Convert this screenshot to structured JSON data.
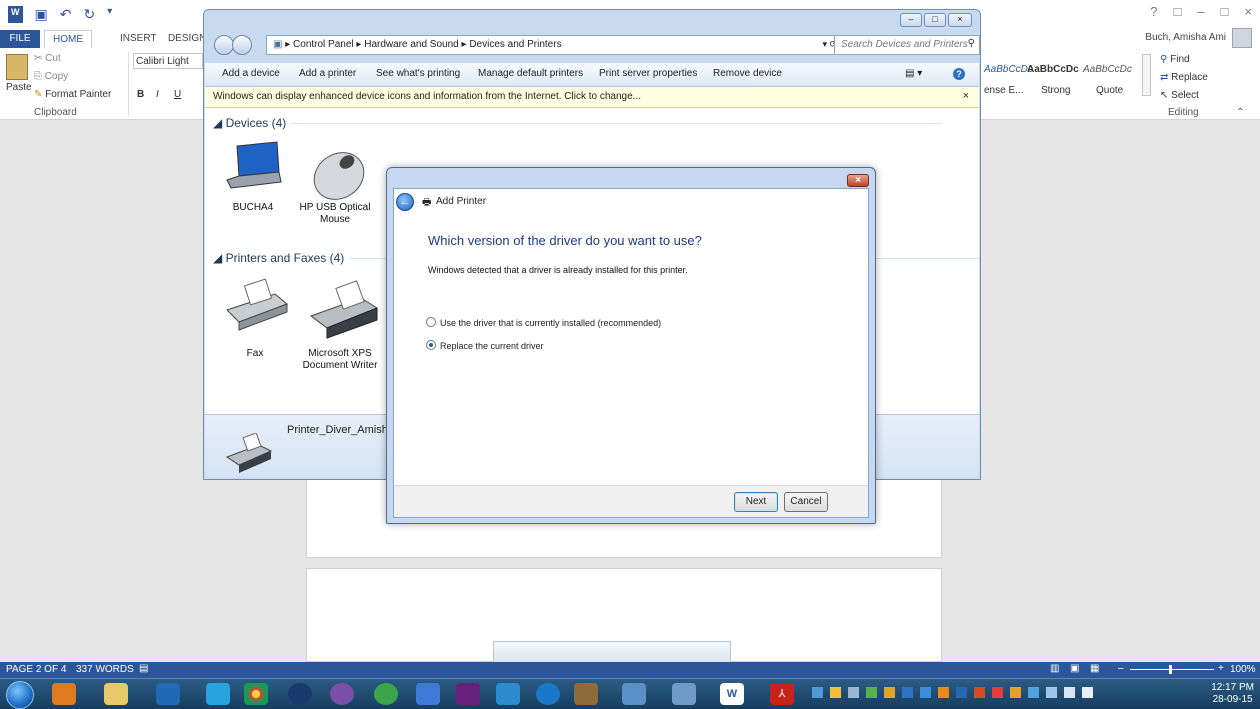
{
  "word": {
    "title_controls": [
      "?",
      "□",
      "–",
      "□",
      "×"
    ],
    "tabs": {
      "file": "FILE",
      "home": "HOME",
      "insert": "INSERT",
      "design": "DESIGN"
    },
    "clipboard": {
      "cut": "Cut",
      "copy": "Copy",
      "paste": "Paste",
      "format_painter": "Format Painter",
      "group_label": "Clipboard"
    },
    "font": {
      "name": "Calibri Light",
      "bold": "B",
      "italic": "I",
      "underline": "U"
    },
    "styles": {
      "style1": "AaBbCcDc",
      "style2": "AaBbCcDc",
      "style3": "AaBbCcDc",
      "label1": "ense E...",
      "label2": "Strong",
      "label3": "Quote"
    },
    "editing": {
      "find": "Find",
      "replace": "Replace",
      "select": "Select",
      "group_label": "Editing"
    },
    "user": "Buch, Amisha Ami",
    "status": {
      "page": "PAGE 2 OF 4",
      "words": "337 WORDS",
      "zoom": "100%"
    }
  },
  "explorer": {
    "breadcrumb": [
      "Control Panel",
      "Hardware and Sound",
      "Devices and Printers"
    ],
    "search_placeholder": "Search Devices and Printers",
    "toolbar": [
      "Add a device",
      "Add a printer",
      "See what's printing",
      "Manage default printers",
      "Print server properties",
      "Remove device"
    ],
    "infobar": "Windows can display enhanced device icons and information from the Internet. Click to change...",
    "groups": {
      "devices": {
        "header": "Devices (4)",
        "items": [
          "BUCHA4",
          "HP USB Optical Mouse"
        ]
      },
      "printers": {
        "header": "Printers and Faxes (4)",
        "items": [
          "Fax",
          "Microsoft XPS Document Writer"
        ]
      }
    },
    "selected_name": "Printer_Diver_Amisha"
  },
  "dialog": {
    "title": "Add Printer",
    "heading": "Which version of the driver do you want to use?",
    "message": "Windows detected that a driver is already installed for this printer.",
    "options": [
      {
        "label": "Use the driver that is currently installed (recommended)",
        "selected": false
      },
      {
        "label": "Replace the current driver",
        "selected": true
      }
    ],
    "next": "Next",
    "cancel": "Cancel"
  },
  "taskbar": {
    "time": "12:17 PM",
    "date": "28-09-15"
  }
}
